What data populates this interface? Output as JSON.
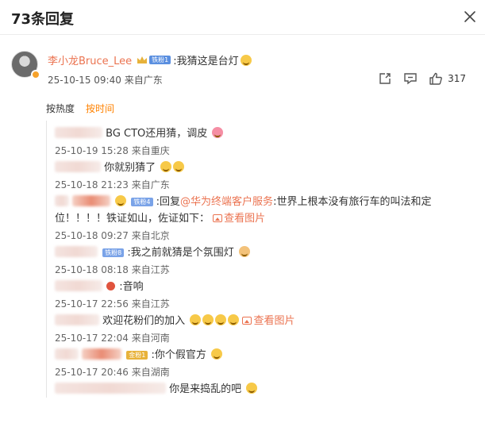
{
  "header": {
    "title": "73条回复"
  },
  "main_comment": {
    "username": "李小龙Bruce_Lee",
    "fan_badge": "铁粉1",
    "text": ":我猜这是台灯",
    "timestamp": "25-10-15 09:40",
    "location": "来自广东",
    "like_count": "317"
  },
  "sort": {
    "hot": "按热度",
    "time": "按时间"
  },
  "replies": [
    {
      "text": "BG CTO还用猜，调皮",
      "timestamp": "25-10-19 15:28",
      "location": "来自重庆"
    },
    {
      "text": "你就别猜了",
      "timestamp": "25-10-18 21:23",
      "location": "来自广东"
    },
    {
      "badge": "铁粉4",
      "prefix": ":回复",
      "mention": "@华为终端客户服务",
      "text": ":世界上根本没有旅行车的叫法和定",
      "text2": "位！！！！铁证如山，佐证如下：",
      "view_pic": "查看图片",
      "timestamp": "25-10-18 09:27",
      "location": "来自北京"
    },
    {
      "badge": "铁粉8",
      "text": ":我之前就猜是个氛围灯",
      "timestamp": "25-10-18 08:18",
      "location": "来自江苏"
    },
    {
      "text": ":音响",
      "timestamp": "25-10-17 22:56",
      "location": "来自江苏"
    },
    {
      "text": "欢迎花粉们的加入",
      "view_pic": "查看图片",
      "timestamp": "25-10-17 22:04",
      "location": "来自河南"
    },
    {
      "badge": "金粉1",
      "text": ":你个假官方",
      "timestamp": "25-10-17 20:46",
      "location": "来自湖南"
    },
    {
      "text": "你是来捣乱的吧"
    }
  ]
}
